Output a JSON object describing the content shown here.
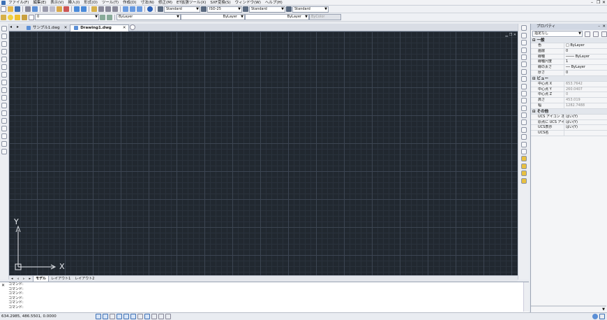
{
  "menu": [
    "ファイル(F)",
    "編集(E)",
    "表示(V)",
    "挿入(I)",
    "形式(O)",
    "ツール(T)",
    "作成(D)",
    "寸法(N)",
    "修正(M)",
    "ET拡張ツール(X)",
    "SXF変換(S)",
    "ウィンドウ(W)",
    "ヘルプ(H)"
  ],
  "toolbar": {
    "textstyle": "Standard",
    "dimstyle": "ISO-25",
    "tablestyle": "Standard",
    "mleaderstyle": "Standard",
    "layer": "0",
    "color": "ByLayer",
    "linetype": "ByLayer",
    "lineweight": "ByLayer",
    "plotstyle": "ByColor"
  },
  "tabs": [
    {
      "label": "サンプル1.dwg",
      "active": false
    },
    {
      "label": "Drawing1.dwg",
      "active": true
    }
  ],
  "ucs": {
    "x": "X",
    "y": "Y"
  },
  "layout_tabs": [
    "モデル",
    "レイアウト1",
    "レイアウト2"
  ],
  "command": {
    "lines": [
      "コマンド:",
      "コマンド:",
      "コマンド:",
      "コマンド:",
      "コマンド:",
      "コマンド:"
    ]
  },
  "properties": {
    "title": "プロパティ",
    "selection": "指定なし",
    "sections": [
      {
        "name": "一般",
        "rows": [
          {
            "k": "色",
            "v": "□ ByLayer"
          },
          {
            "k": "画層",
            "v": "0"
          },
          {
            "k": "線種",
            "v": "──── ByLayer"
          },
          {
            "k": "線種尺度",
            "v": "1"
          },
          {
            "k": "線の太さ",
            "v": "── ByLayer"
          },
          {
            "k": "厚さ",
            "v": "0"
          }
        ]
      },
      {
        "name": "ビュー",
        "rows": [
          {
            "k": "中心点 X",
            "v": "653.7642",
            "ro": true
          },
          {
            "k": "中心点 Y",
            "v": "260.0407",
            "ro": true
          },
          {
            "k": "中心点 Z",
            "v": "0",
            "ro": true
          },
          {
            "k": "高さ",
            "v": "453.019",
            "ro": true
          },
          {
            "k": "幅",
            "v": "1282.7488",
            "ro": true
          }
        ]
      },
      {
        "name": "その他",
        "rows": [
          {
            "k": "UCS アイコン オン",
            "v": "はい(Y)"
          },
          {
            "k": "原点に UCS アイコン",
            "v": "はい(Y)"
          },
          {
            "k": "UCS表示",
            "v": "はい(Y)"
          },
          {
            "k": "UCS名",
            "v": ""
          }
        ]
      }
    ]
  },
  "status": {
    "coords": "634.2985, 486.5501, 0.0000"
  },
  "colors": {
    "canvas": "#212830",
    "grid_major": "#3c4552",
    "accent": "#3c6fb5"
  }
}
